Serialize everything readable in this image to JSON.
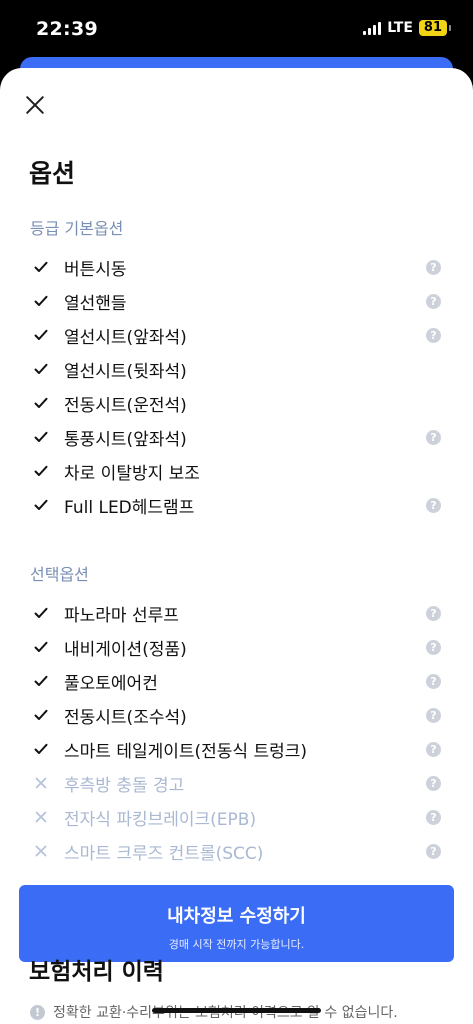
{
  "status_bar": {
    "time": "22:39",
    "network": "LTE",
    "battery": "81"
  },
  "sheet": {
    "title": "옵션"
  },
  "sections": [
    {
      "title": "등급 기본옵션",
      "items": [
        {
          "label": "버튼시동",
          "included": true,
          "help": true
        },
        {
          "label": "열선핸들",
          "included": true,
          "help": true
        },
        {
          "label": "열선시트(앞좌석)",
          "included": true,
          "help": true
        },
        {
          "label": "열선시트(뒷좌석)",
          "included": true,
          "help": false
        },
        {
          "label": "전동시트(운전석)",
          "included": true,
          "help": false
        },
        {
          "label": "통풍시트(앞좌석)",
          "included": true,
          "help": true
        },
        {
          "label": "차로 이탈방지 보조",
          "included": true,
          "help": false
        },
        {
          "label": "Full LED헤드램프",
          "included": true,
          "help": true
        }
      ]
    },
    {
      "title": "선택옵션",
      "items": [
        {
          "label": "파노라마 선루프",
          "included": true,
          "help": true
        },
        {
          "label": "내비게이션(정품)",
          "included": true,
          "help": true
        },
        {
          "label": "풀오토에어컨",
          "included": true,
          "help": true
        },
        {
          "label": "전동시트(조수석)",
          "included": true,
          "help": true
        },
        {
          "label": "스마트 테일게이트(전동식 트렁크)",
          "included": true,
          "help": true
        },
        {
          "label": "후측방 충돌 경고",
          "included": false,
          "help": true
        },
        {
          "label": "전자식 파킹브레이크(EPB)",
          "included": false,
          "help": true
        },
        {
          "label": "스마트 크루즈 컨트롤(SCC)",
          "included": false,
          "help": true
        }
      ]
    }
  ],
  "cta": {
    "label": "내차정보 수정하기",
    "sublabel": "경매 시작 전까지 가능합니다."
  },
  "history": {
    "title": "보험처리 이력",
    "notice": "정확한 교환·수리부위는 보험처리 이력으로 알 수 없습니다."
  },
  "icons": {
    "help": "?",
    "info": "!"
  },
  "colors": {
    "accent": "#3a6cf5",
    "section_title": "#7a8fb4",
    "disabled": "#a9b8d3",
    "battery": "#f2d417"
  }
}
